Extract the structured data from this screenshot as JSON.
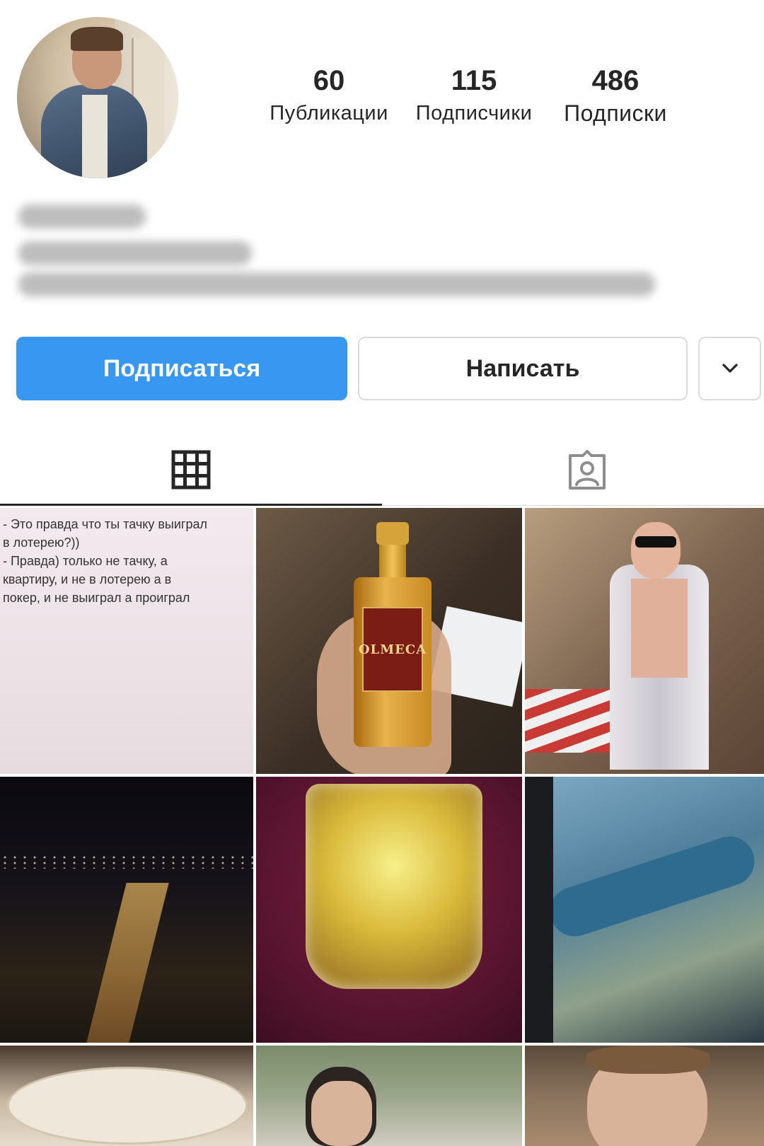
{
  "profile": {
    "stats": [
      {
        "value": "60",
        "label": "Публикации"
      },
      {
        "value": "115",
        "label": "Подписчики"
      },
      {
        "value": "486",
        "label": "Подписки"
      }
    ]
  },
  "buttons": {
    "follow": "Подписаться",
    "message": "Написать"
  },
  "tabs": {
    "active": "grid"
  },
  "posts": {
    "text_post_lines": [
      "- Это правда что ты тачку выиграл",
      "в лотерею?))",
      "- Правда) только не тачку, а",
      "квартиру, и не в лотерею а в",
      "покер, и не выиграл а проиграл"
    ],
    "bottle_brand": "OLMECA"
  },
  "colors": {
    "follow_button": "#3897f0",
    "text": "#262626",
    "border": "#dbdbdb"
  }
}
